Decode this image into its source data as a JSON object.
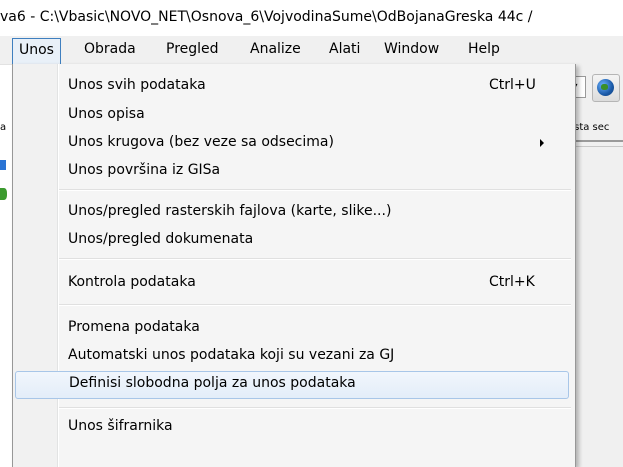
{
  "window": {
    "title": "va6 - C:\\Vbasic\\NOVO_NET\\Osnova_6\\VojvodinaSume\\OdBojanaGreska 44c /"
  },
  "menubar": {
    "items": [
      {
        "label": "Unos"
      },
      {
        "label": "Obrada"
      },
      {
        "label": "Pregled"
      },
      {
        "label": "Analize"
      },
      {
        "label": "Alati"
      },
      {
        "label": "Window"
      },
      {
        "label": "Help"
      }
    ],
    "active": "Unos"
  },
  "background": {
    "tab_fragment": "rsta sec",
    "left_fragment": "a"
  },
  "dropdown": {
    "items": [
      {
        "label": "Unos svih podataka",
        "shortcut": "Ctrl+U"
      },
      {
        "label": "Unos opisa"
      },
      {
        "label": "Unos krugova (bez veze sa odsecima)",
        "submenu": true
      },
      {
        "label": "Unos površina iz GISa"
      },
      {
        "label": "Unos/pregled rasterskih fajlova (karte, slike...)"
      },
      {
        "label": "Unos/pregled dokumenata"
      },
      {
        "label": "Kontrola podataka",
        "shortcut": "Ctrl+K"
      },
      {
        "label": "Promena podataka"
      },
      {
        "label": "Automatski unos podataka koji su vezani za GJ"
      },
      {
        "label": "Definisi slobodna polja za unos podataka",
        "highlighted": true
      },
      {
        "label": "Unos šifrarnika"
      }
    ]
  },
  "colors": {
    "menu_bg": "#f5f5f5",
    "highlight_border": "#a8c6e8",
    "active_menu_border": "#3f7fbf"
  },
  "icons": [
    "globe-icon",
    "submenu-arrow-icon",
    "dropdown-arrow-icon"
  ]
}
